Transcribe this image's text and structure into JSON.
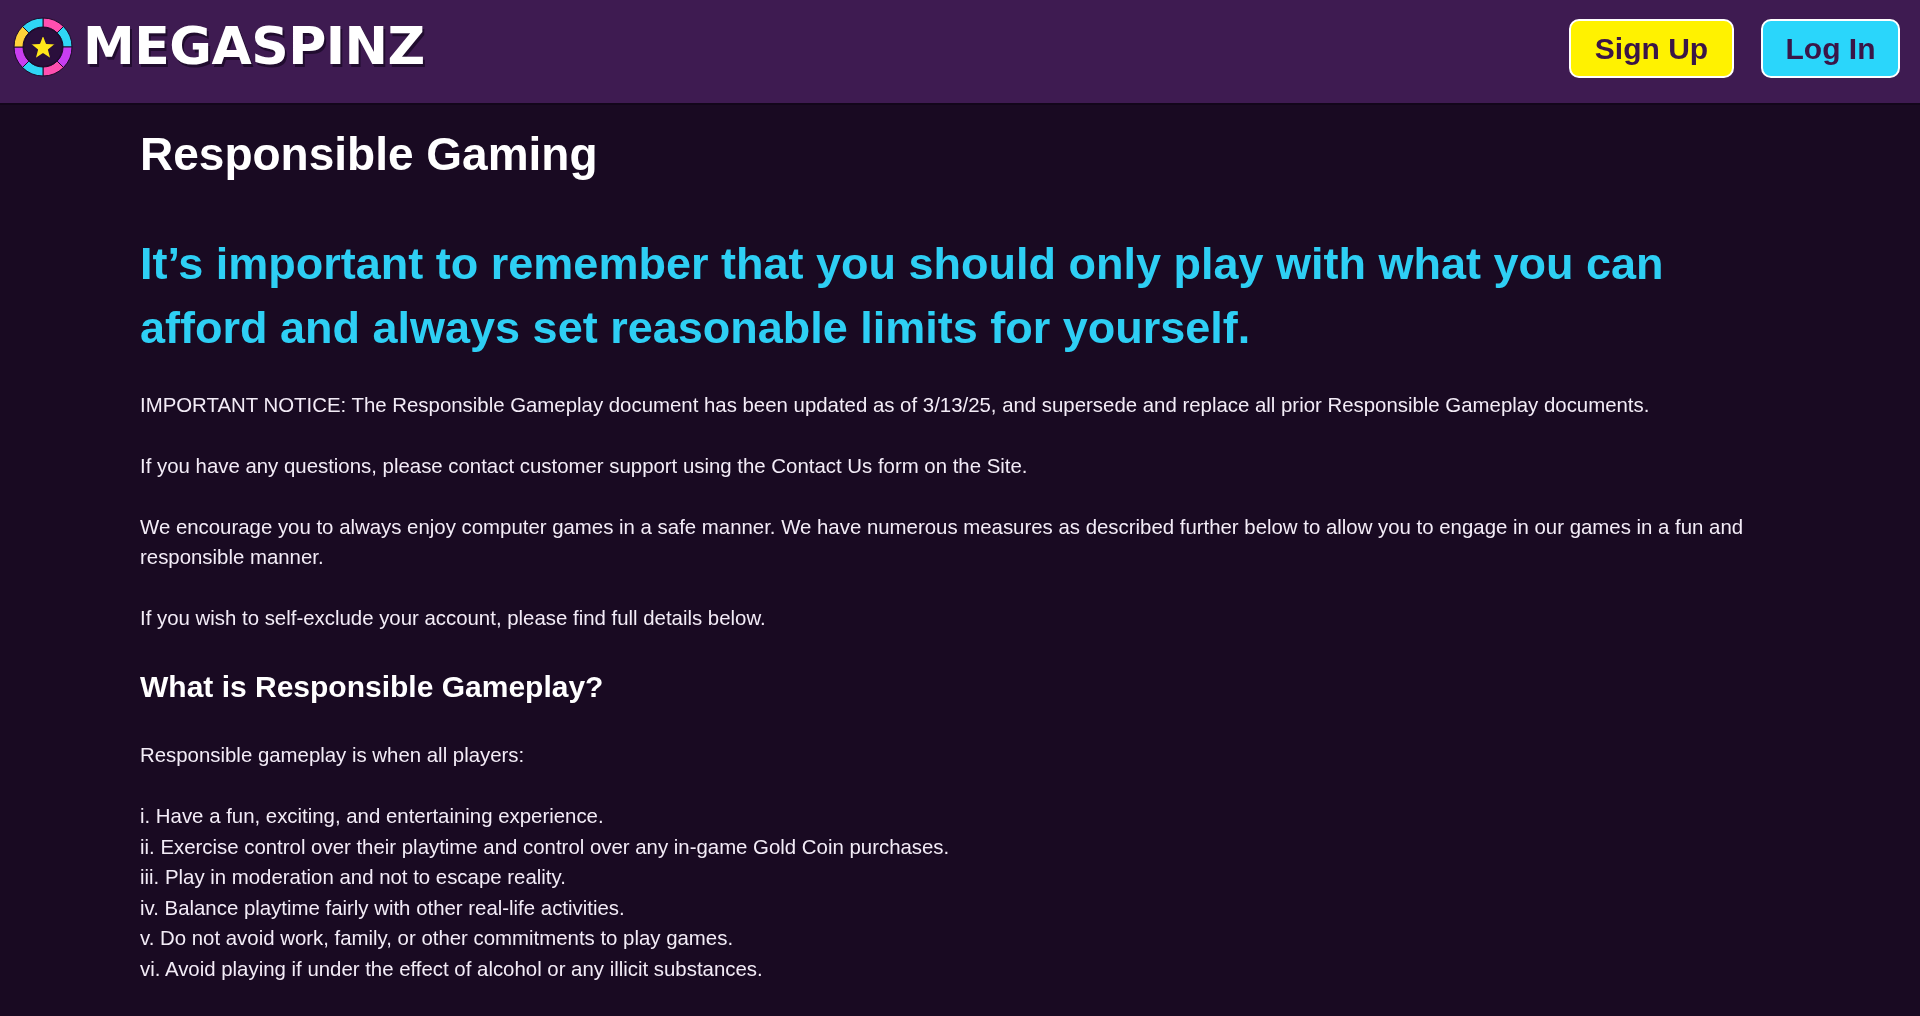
{
  "header": {
    "logo": {
      "text": "MEGASPINZ"
    },
    "buttons": [
      {
        "label": "Sign Up",
        "kind": "signup"
      },
      {
        "label": "Log In",
        "kind": "login"
      }
    ]
  },
  "page": {
    "title": "Responsible Gaming",
    "highlight": "It’s important to remember that you should only play with what you can afford and always set reasonable limits for yourself.",
    "paragraphs": [
      "IMPORTANT NOTICE: The Responsible Gameplay document has been updated as of 3/13/25, and supersede and replace all prior Responsible Gameplay documents.",
      "If you have any questions, please contact customer support using the Contact Us form on the Site.",
      "We encourage you to always enjoy computer games in a safe manner. We have numerous measures as described further below to allow you to engage in our games in a fun and responsible manner.",
      "If you wish to self-exclude your account, please find full details below."
    ],
    "sections": [
      {
        "heading": "What is Responsible Gameplay?",
        "intro": "Responsible gameplay is when all players:",
        "items": [
          "i. Have a fun, exciting, and entertaining experience.",
          "ii. Exercise control over their playtime and control over any in-game Gold Coin purchases.",
          "iii. Play in moderation and not to escape reality.",
          "iv. Balance playtime fairly with other real-life activities.",
          "v. Do not avoid work, family, or other commitments to play games.",
          "vi. Avoid playing if under the effect of alcohol or any illicit substances."
        ]
      }
    ]
  }
}
